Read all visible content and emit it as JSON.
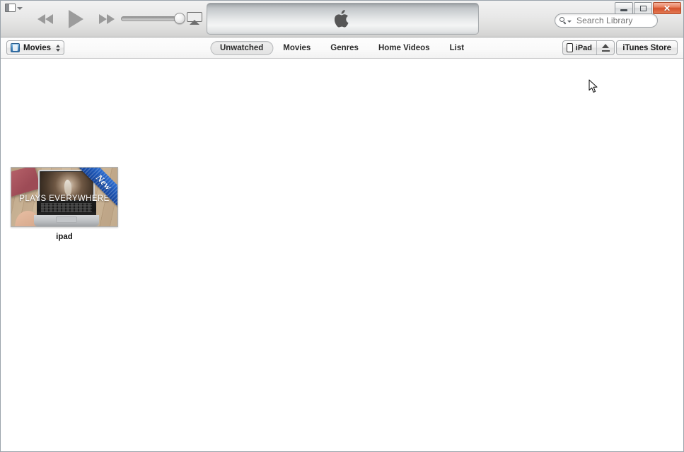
{
  "window": {
    "controls": {
      "minimize_label": "—",
      "maximize_label": "❐",
      "close_label": "✕"
    }
  },
  "toolbar": {
    "view_toggle_name": "sidebar-toggle",
    "previous_label": "Previous",
    "play_label": "Play",
    "next_label": "Next",
    "volume_value": "100",
    "airplay_label": "AirPlay",
    "display": {
      "logo": "apple-logo"
    },
    "search": {
      "placeholder": "Search Library",
      "value": ""
    }
  },
  "navbar": {
    "library": {
      "icon": "movies-film-icon",
      "label": "Movies"
    },
    "tabs": [
      {
        "label": "Unwatched",
        "active": true
      },
      {
        "label": "Movies",
        "active": false
      },
      {
        "label": "Genres",
        "active": false
      },
      {
        "label": "Home Videos",
        "active": false
      },
      {
        "label": "List",
        "active": false
      }
    ],
    "device": {
      "icon": "ipad-device-icon",
      "label": "iPad",
      "eject_icon": "eject-icon"
    },
    "store_label": "iTunes Store"
  },
  "content": {
    "items": [
      {
        "title": "ipad",
        "overlay_text": "PLAYS EVERYWHERE",
        "badge": "New",
        "badge_color": "#1e56b4"
      }
    ]
  },
  "colors": {
    "toolbar_top": "#e8e8e8",
    "navbar": "#fafafa",
    "content_bg": "#ffffff",
    "close_button": "#d4512c",
    "ribbon_blue": "#1e56b4"
  }
}
